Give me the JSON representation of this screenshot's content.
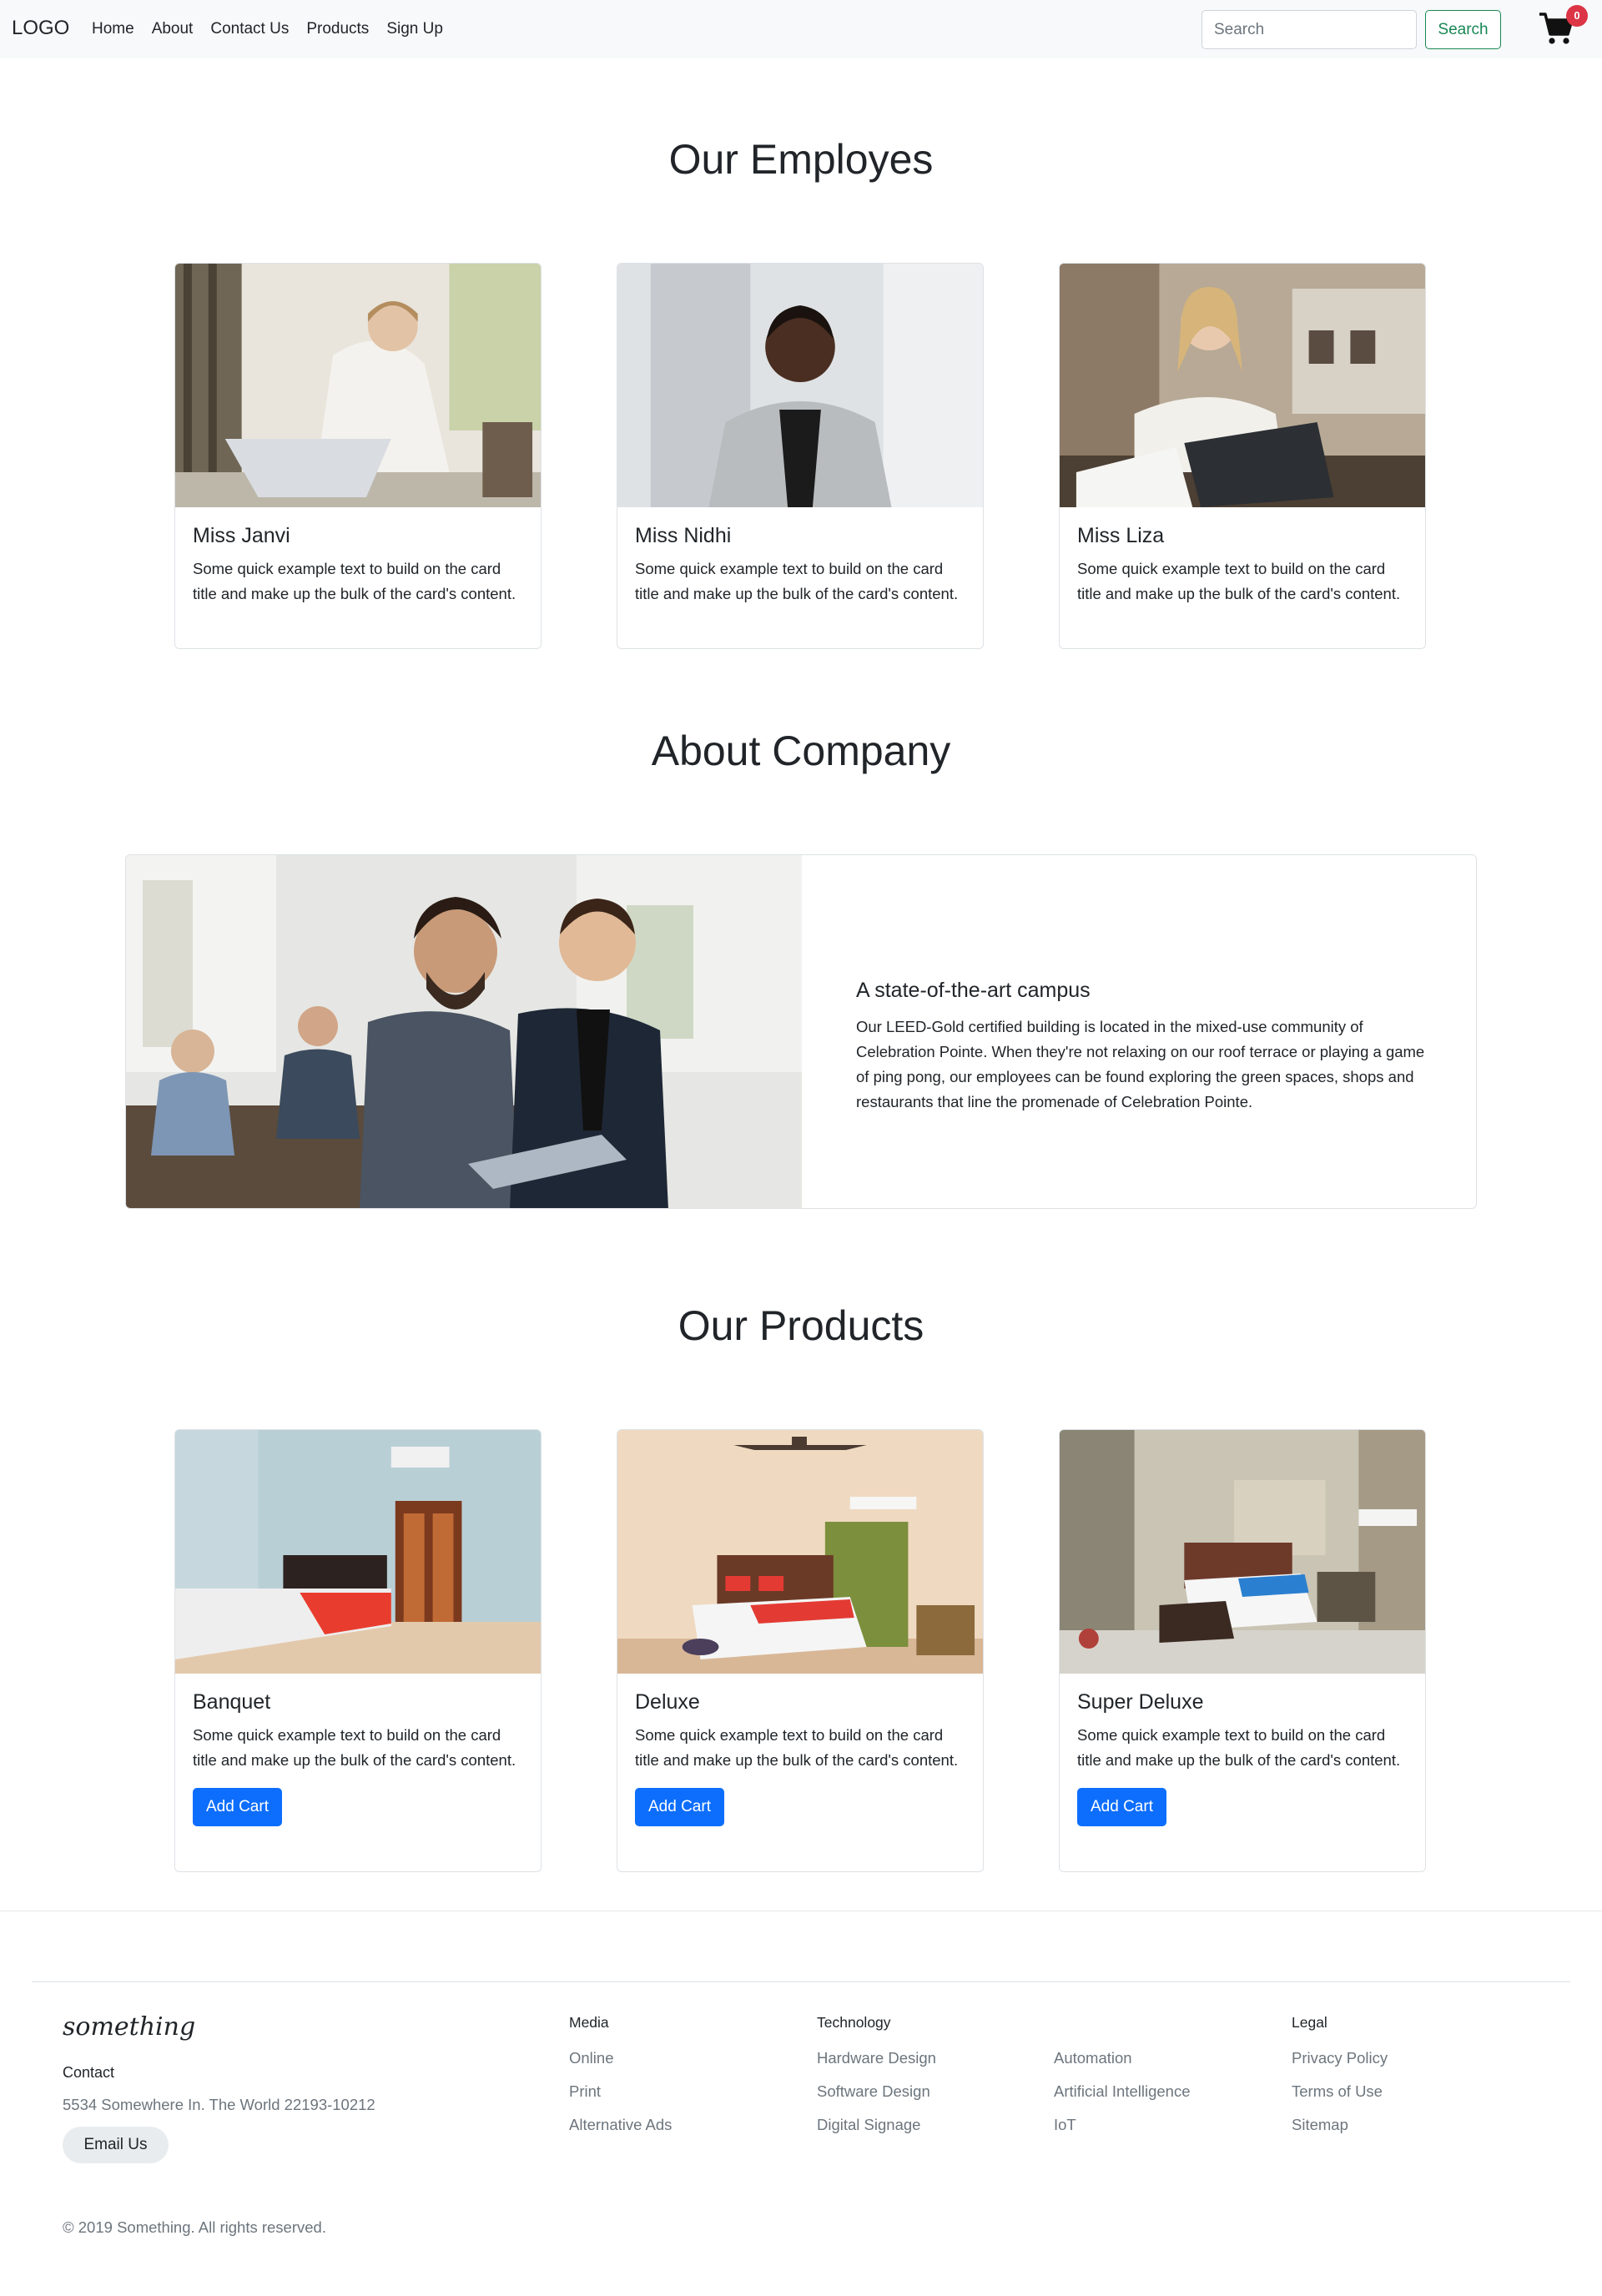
{
  "navbar": {
    "logo": "LOGO",
    "links": [
      "Home",
      "About",
      "Contact Us",
      "Products",
      "Sign Up"
    ],
    "search_placeholder": "Search",
    "search_button": "Search",
    "cart_count": "0"
  },
  "employees": {
    "title": "Our Employes",
    "cards": [
      {
        "name": "Miss Janvi",
        "text": "Some quick example text to build on the card title and make up the bulk of the card's content."
      },
      {
        "name": "Miss Nidhi",
        "text": "Some quick example text to build on the card title and make up the bulk of the card's content."
      },
      {
        "name": "Miss Liza",
        "text": "Some quick example text to build on the card title and make up the bulk of the card's content."
      }
    ]
  },
  "about": {
    "title": "About Company",
    "heading": "A state-of-the-art campus",
    "body": "Our LEED-Gold certified building is located in the mixed-use community of Celebration Pointe. When they're not relaxing on our roof terrace or playing a game of ping pong, our employees can be found exploring the green spaces, shops and restaurants that line the promenade of Celebration Pointe."
  },
  "products": {
    "title": "Our Products",
    "button_label": "Add Cart",
    "cards": [
      {
        "name": "Banquet",
        "text": "Some quick example text to build on the card title and make up the bulk of the card's content."
      },
      {
        "name": "Deluxe",
        "text": "Some quick example text to build on the card title and make up the bulk of the card's content."
      },
      {
        "name": "Super Deluxe",
        "text": "Some quick example text to build on the card title and make up the bulk of the card's content."
      }
    ]
  },
  "footer": {
    "brand": "something",
    "contact_label": "Contact",
    "address": "5534 Somewhere In. The World 22193-10212",
    "email_button": "Email Us",
    "columns": [
      {
        "heading": "Media",
        "links": [
          "Online",
          "Print",
          "Alternative Ads"
        ]
      },
      {
        "heading": "Technology",
        "links": [
          "Hardware Design",
          "Software Design",
          "Digital Signage"
        ]
      },
      {
        "heading": "",
        "links": [
          "Automation",
          "Artificial Intelligence",
          "IoT"
        ]
      },
      {
        "heading": "Legal",
        "links": [
          "Privacy Policy",
          "Terms of Use",
          "Sitemap"
        ]
      }
    ],
    "copyright": "© 2019 Something. All rights reserved."
  }
}
